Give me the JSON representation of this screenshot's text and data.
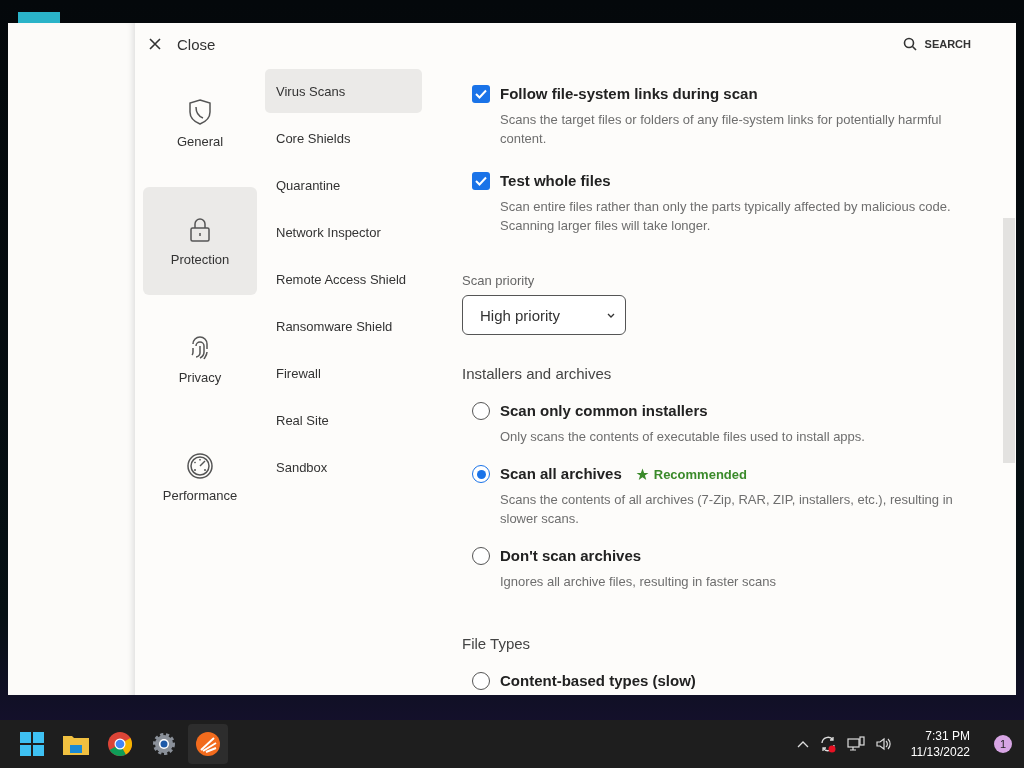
{
  "close": {
    "label": "Close"
  },
  "search": {
    "label": "SEARCH"
  },
  "categories": [
    {
      "label": "General",
      "selected": false
    },
    {
      "label": "Protection",
      "selected": true
    },
    {
      "label": "Privacy",
      "selected": false
    },
    {
      "label": "Performance",
      "selected": false
    }
  ],
  "subnav": [
    {
      "label": "Virus Scans",
      "selected": true
    },
    {
      "label": "Core Shields",
      "selected": false
    },
    {
      "label": "Quarantine",
      "selected": false
    },
    {
      "label": "Network Inspector",
      "selected": false
    },
    {
      "label": "Remote Access Shield",
      "selected": false
    },
    {
      "label": "Ransomware Shield",
      "selected": false
    },
    {
      "label": "Firewall",
      "selected": false
    },
    {
      "label": "Real Site",
      "selected": false
    },
    {
      "label": "Sandbox",
      "selected": false
    }
  ],
  "checkboxes": [
    {
      "title": "Follow file-system links during scan",
      "description": "Scans the target files or folders of any file-system links for potentially harmful content.",
      "checked": true
    },
    {
      "title": "Test whole files",
      "description": "Scan entire files rather than only the parts typically affected by malicious code. Scanning larger files will take longer.",
      "checked": true
    }
  ],
  "scan_priority": {
    "label": "Scan priority",
    "value": "High priority"
  },
  "installers": {
    "heading": "Installers and archives",
    "options": [
      {
        "title": "Scan only common installers",
        "description": "Only scans the contents of executable files used to install apps.",
        "selected": false
      },
      {
        "title": "Scan all archives",
        "badge": "Recommended",
        "description": "Scans the contents of all archives (7-Zip, RAR, ZIP, installers, etc.), resulting in slower scans.",
        "selected": true
      },
      {
        "title": "Don't scan archives",
        "description": "Ignores all archive files, resulting in faster scans",
        "selected": false
      }
    ]
  },
  "file_types": {
    "heading": "File Types",
    "options": [
      {
        "title": "Content-based types (slow)",
        "selected": false
      }
    ]
  },
  "taskbar": {
    "time": "7:31 PM",
    "date": "11/13/2022",
    "notifications": "1"
  }
}
